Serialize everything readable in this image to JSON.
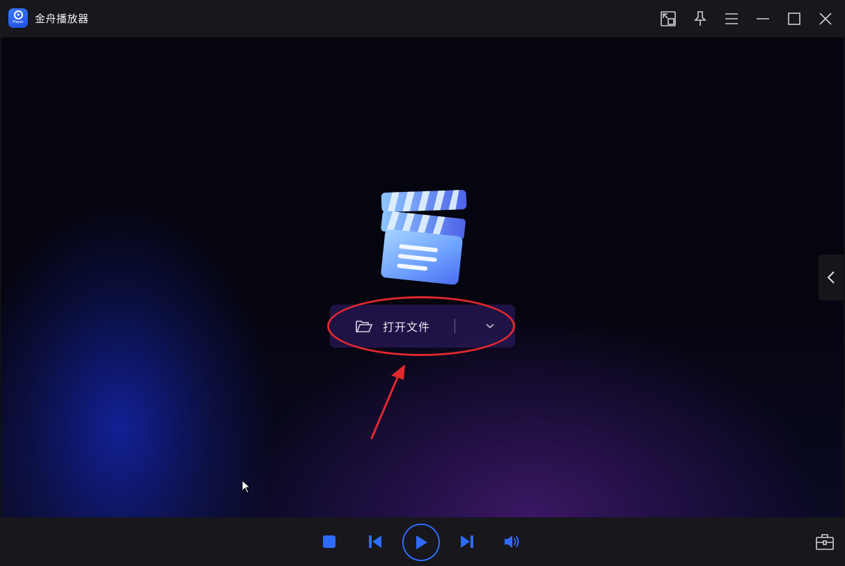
{
  "app": {
    "title": "金舟播放器",
    "logo_text": "Player"
  },
  "titlebar": {
    "icons": [
      "mini-mode-icon",
      "pin-icon",
      "menu-icon",
      "minimize-icon",
      "maximize-icon",
      "close-icon"
    ]
  },
  "main": {
    "open_file_label": "打开文件"
  },
  "controls": {
    "icons": [
      "stop-icon",
      "previous-icon",
      "play-icon",
      "next-icon",
      "volume-icon",
      "toolbox-icon"
    ]
  },
  "colors": {
    "accent": "#2f6bff",
    "annotation": "#e0282e",
    "titlebar": "#17171c"
  }
}
